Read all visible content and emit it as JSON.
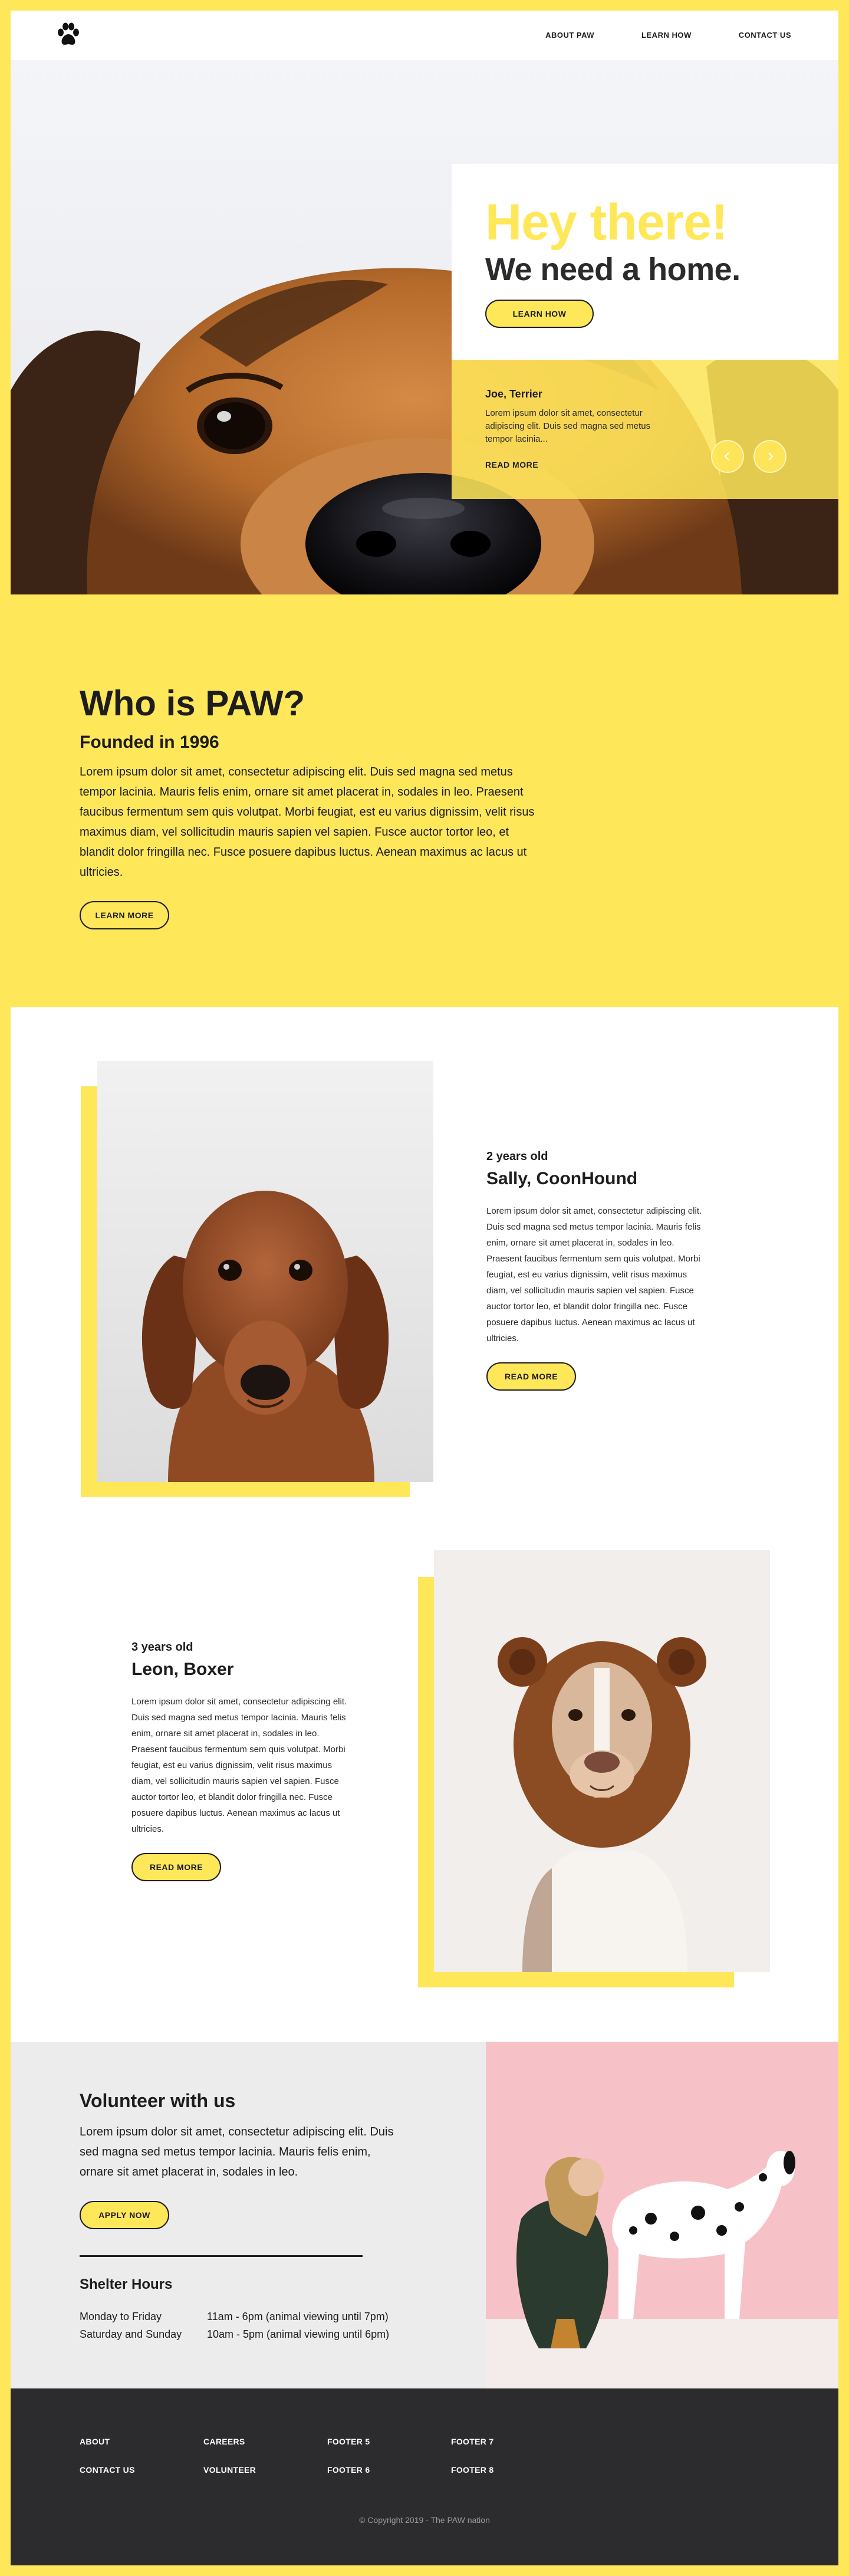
{
  "nav": {
    "logo_icon": "paw-icon",
    "links": [
      "ABOUT PAW",
      "LEARN HOW",
      "CONTACT US"
    ]
  },
  "hero": {
    "title": "Hey there!",
    "subtitle": "We need a home.",
    "button": "LEARN HOW",
    "testimonial": {
      "name": "Joe, Terrier",
      "text": "Lorem ipsum dolor sit amet, consectetur adipiscing elit. Duis sed magna sed metus tempor lacinia...",
      "link": "READ MORE"
    },
    "prev_icon": "chevron-left-icon",
    "next_icon": "chevron-right-icon"
  },
  "about": {
    "title": "Who is PAW?",
    "subtitle": "Founded in 1996",
    "text": "Lorem ipsum dolor sit amet, consectetur adipiscing elit. Duis sed magna sed metus tempor lacinia. Mauris felis enim, ornare sit amet placerat in, sodales in leo. Praesent faucibus fermentum sem quis volutpat. Morbi feugiat, est eu varius dignissim, velit risus maximus diam, vel sollicitudin mauris sapien vel sapien. Fusce auctor tortor leo, et blandit dolor fringilla nec. Fusce posuere dapibus luctus. Aenean maximus ac lacus ut ultricies.",
    "button": "LEARN MORE"
  },
  "dogs": [
    {
      "age": "2 years old",
      "name": "Sally, CoonHound",
      "text": "Lorem ipsum dolor sit amet, consectetur adipiscing elit. Duis sed magna sed metus tempor lacinia. Mauris felis enim, ornare sit amet placerat in, sodales in leo. Praesent faucibus fermentum sem quis volutpat. Morbi feugiat, est eu varius dignissim, velit risus maximus diam, vel sollicitudin mauris sapien vel sapien. Fusce auctor tortor leo, et blandit dolor fringilla nec. Fusce posuere dapibus luctus. Aenean maximus ac lacus ut ultricies.",
      "button": "READ MORE"
    },
    {
      "age": "3 years old",
      "name": "Leon, Boxer",
      "text": "Lorem ipsum dolor sit amet, consectetur adipiscing elit. Duis sed magna sed metus tempor lacinia. Mauris felis enim, ornare sit amet placerat in, sodales in leo. Praesent faucibus fermentum sem quis volutpat. Morbi feugiat, est eu varius dignissim, velit risus maximus diam, vel sollicitudin mauris sapien vel sapien. Fusce auctor tortor leo, et blandit dolor fringilla nec. Fusce posuere dapibus luctus. Aenean maximus ac lacus ut ultricies.",
      "button": "READ MORE"
    }
  ],
  "volunteer": {
    "title": "Volunteer with us",
    "text": "Lorem ipsum dolor sit amet, consectetur adipiscing elit. Duis sed magna sed metus tempor lacinia. Mauris felis enim, ornare sit amet placerat in, sodales in leo.",
    "button": "APPLY NOW",
    "hours_title": "Shelter Hours",
    "hours": [
      {
        "day": "Monday to Friday",
        "time": "11am - 6pm (animal viewing until 7pm)"
      },
      {
        "day": "Saturday and Sunday",
        "time": "10am - 5pm (animal viewing until 6pm)"
      }
    ]
  },
  "footer": {
    "links": [
      "ABOUT",
      "CAREERS",
      "FOOTER 5",
      "FOOTER 7",
      "CONTACT US",
      "VOLUNTEER",
      "FOOTER 6",
      "FOOTER 8"
    ],
    "copyright": "© Copyright 2019 - The PAW nation"
  },
  "colors": {
    "accent": "#FFE75A",
    "dark": "#2c2c2e",
    "text": "#1d1d1f"
  }
}
